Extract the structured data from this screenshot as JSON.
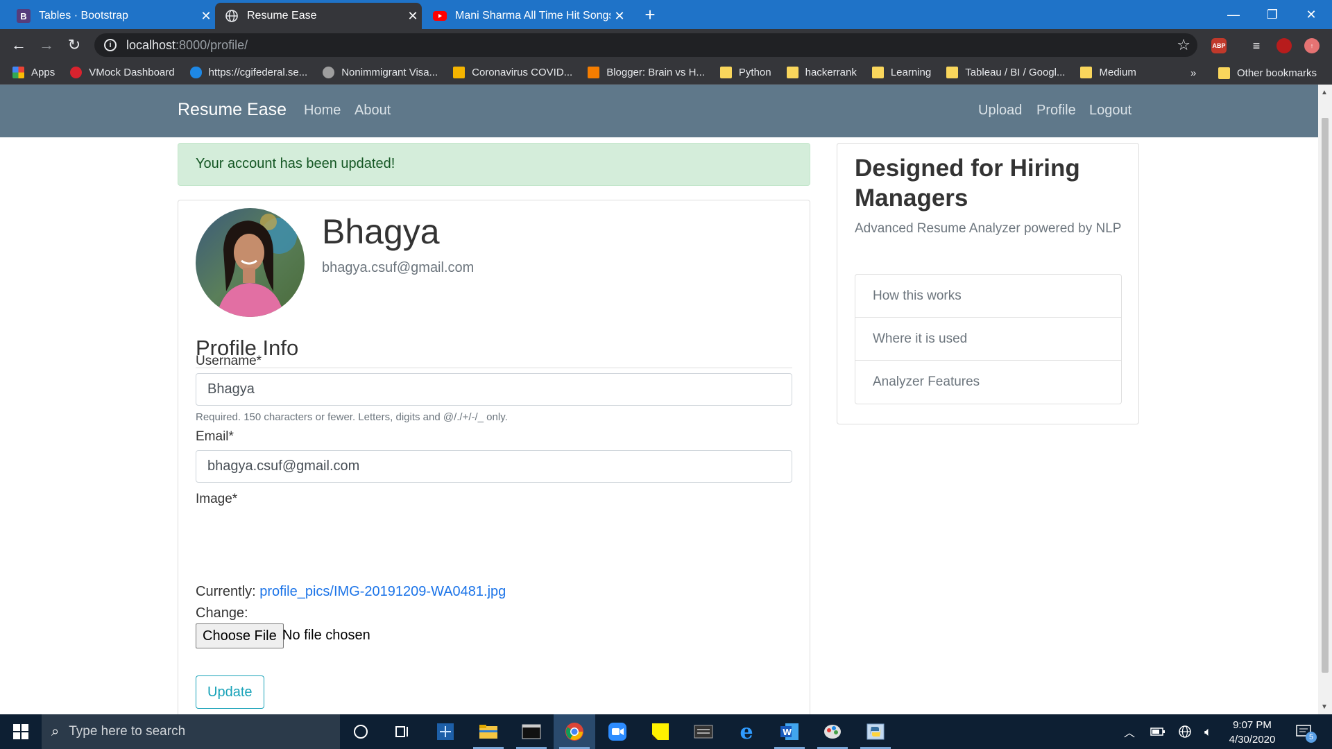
{
  "browser": {
    "tabs": [
      {
        "title": "Tables · Bootstrap",
        "icon": "bootstrap-icon",
        "icon_text": "B",
        "active": false
      },
      {
        "title": "Resume Ease",
        "icon": "globe-icon",
        "active": true
      },
      {
        "title": "Mani Sharma All Time Hit Songs",
        "icon": "youtube-icon",
        "active": false
      }
    ],
    "url_host": "localhost",
    "url_rest": ":8000/profile/",
    "bookmarks": [
      {
        "label": "Apps",
        "icon": "apps-icon",
        "color": "#e8453c"
      },
      {
        "label": "VMock Dashboard",
        "icon": "vmock-icon",
        "color": "#d9232e"
      },
      {
        "label": "https://cgifederal.se...",
        "icon": "cloud-icon",
        "color": "#1e88e5"
      },
      {
        "label": "Nonimmigrant Visa...",
        "icon": "seal-icon",
        "color": "#9e9e9e"
      },
      {
        "label": "Coronavirus COVID...",
        "icon": "cdc-icon",
        "color": "#f4b400"
      },
      {
        "label": "Blogger: Brain vs H...",
        "icon": "blogger-icon",
        "color": "#f57d00"
      },
      {
        "label": "Python",
        "icon": "folder-icon",
        "color": "#f9d65c"
      },
      {
        "label": "hackerrank",
        "icon": "folder-icon",
        "color": "#f9d65c"
      },
      {
        "label": "Learning",
        "icon": "folder-icon",
        "color": "#f9d65c"
      },
      {
        "label": "Tableau / BI / Googl...",
        "icon": "folder-icon",
        "color": "#f9d65c"
      },
      {
        "label": "Medium",
        "icon": "folder-icon",
        "color": "#f9d65c"
      }
    ],
    "overflow_label": "»",
    "other_bookmarks": "Other bookmarks"
  },
  "site": {
    "brand": "Resume Ease",
    "nav_left": [
      "Home",
      "About"
    ],
    "nav_right": [
      "Upload",
      "Profile",
      "Logout"
    ]
  },
  "alert": "Your account has been updated!",
  "profile": {
    "name": "Bhagya",
    "email": "bhagya.csuf@gmail.com",
    "section_title": "Profile Info",
    "username_label": "Username*",
    "username_value": "Bhagya",
    "username_help": "Required. 150 characters or fewer. Letters, digits and @/./+/-/_ only.",
    "email_label": "Email*",
    "email_value": "bhagya.csuf@gmail.com",
    "image_label": "Image*",
    "currently_label": "Currently:",
    "current_image": "profile_pics/IMG-20191209-WA0481.jpg",
    "change_label": "Change:",
    "choose_file": "Choose File",
    "no_file": "No file chosen",
    "update_button": "Update"
  },
  "sidebar": {
    "title": "Designed for Hiring Managers",
    "subtitle": "Advanced Resume Analyzer powered by NLP",
    "items": [
      "How this works",
      "Where it is used",
      "Analyzer Features"
    ]
  },
  "taskbar": {
    "search_placeholder": "Type here to search",
    "time": "9:07 PM",
    "date": "4/30/2020",
    "notification_count": "5",
    "apps": [
      "cortana-icon",
      "task-view-icon",
      "snipping-icon",
      "file-explorer-icon",
      "terminal-icon",
      "chrome-icon",
      "zoom-icon",
      "sticky-notes-icon",
      "keyboard-app-icon",
      "edge-icon",
      "word-icon",
      "paint-icon",
      "python-icon"
    ]
  },
  "colors": {
    "tab_strip": "#1f73c8",
    "navbar": "#5f788a",
    "alert_bg": "#d4edda",
    "link": "#1a73e8",
    "update_outline": "#17a2b8",
    "taskbar": "#0d1f33"
  }
}
